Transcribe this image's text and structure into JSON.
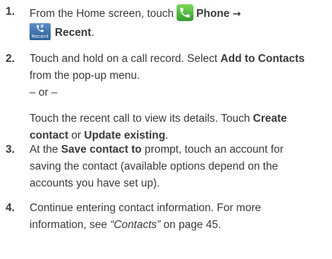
{
  "steps": [
    {
      "number": "1.",
      "line1_text": "From the Home screen, touch",
      "phone_label": "Phone",
      "arrow": "→",
      "recent_icon_text": "Recent",
      "recent_label": "Recent",
      "end": "."
    },
    {
      "number": "2.",
      "line1_text": "Touch and hold on a call record. Select ",
      "line1_bold": "Add to Contacts",
      "line2_text": "from the pop-up menu.",
      "separator": "– or –",
      "line4_text": "Touch the recent call to view its details. Touch ",
      "line4_bold": "Create",
      "line5_bold_a": "contact",
      "line5_or": " or ",
      "line5_bold_b": "Update existing",
      "line5_end": "."
    },
    {
      "number": "3.",
      "line1_pre": "At the ",
      "line1_bold": "Save contact to",
      "line1_post": " prompt, touch an account for",
      "line2_text": "saving the contact (available options depend on the",
      "line3_text": "accounts you have set up)."
    },
    {
      "number": "4.",
      "line1_text": "Continue entering contact information. For more",
      "line2_pre": "information, see ",
      "line2_italic": "“Contacts”",
      "line2_post": " on page 45."
    }
  ],
  "colors": {
    "text": "#3a3a3a",
    "phone_icon": "#3fae3f",
    "recent_icon": "#3a6fab"
  },
  "icons": {
    "phone": "phone-handset-icon",
    "recent": "recent-calls-icon"
  }
}
